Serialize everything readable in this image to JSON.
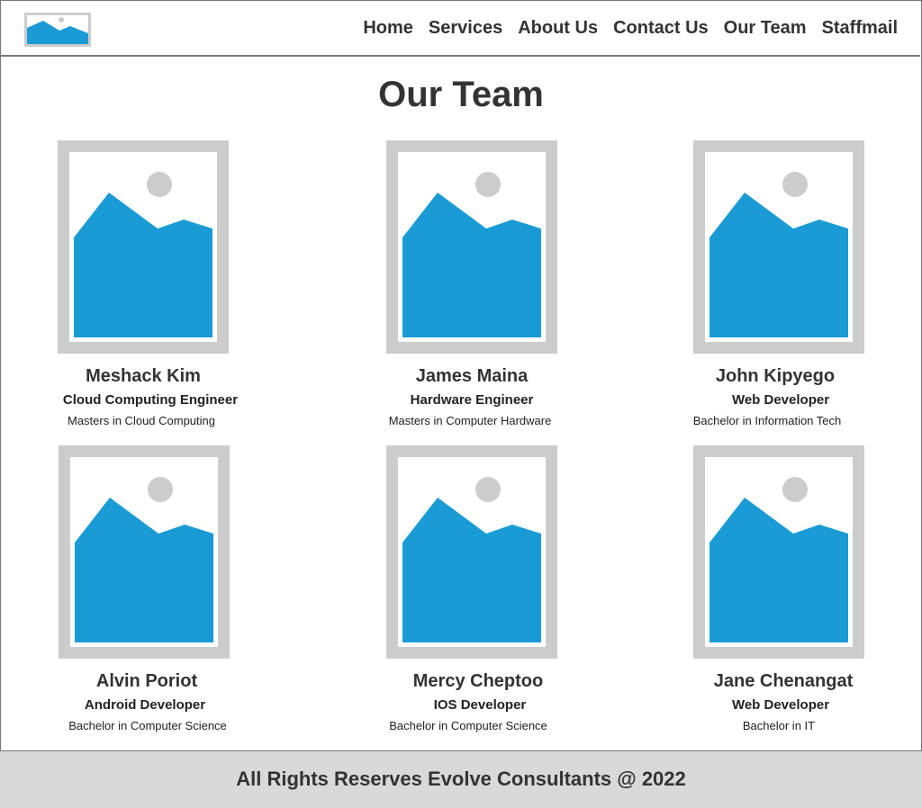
{
  "nav": {
    "items": [
      "Home",
      "Services",
      "About Us",
      "Contact Us",
      "Our Team",
      "Staffmail"
    ]
  },
  "page": {
    "title": "Our Team"
  },
  "team": [
    {
      "name": "Meshack Kim",
      "role": "Cloud Computing Engineer",
      "degree": "Masters in Cloud Computing"
    },
    {
      "name": "James Maina",
      "role": "Hardware Engineer",
      "degree": "Masters in Computer Hardware"
    },
    {
      "name": "John Kipyego",
      "role": "Web Developer",
      "degree": "Bachelor in Information Tech"
    },
    {
      "name": "Alvin Poriot",
      "role": "Android Developer",
      "degree": "Bachelor in Computer Science"
    },
    {
      "name": "Mercy Cheptoo",
      "role": "IOS Developer",
      "degree": "Bachelor in Computer Science"
    },
    {
      "name": "Jane Chenangat",
      "role": "Web Developer",
      "degree": "Bachelor in IT"
    }
  ],
  "footer": {
    "text": "All Rights Reserves Evolve Consultants @ 2022"
  },
  "colors": {
    "placeholder_frame": "#cccccc",
    "placeholder_mountain": "#1a9bd5",
    "footer_bg": "#d9d9d9"
  },
  "icons": {
    "logo": "image-placeholder-icon",
    "member_photo": "image-placeholder-icon"
  }
}
